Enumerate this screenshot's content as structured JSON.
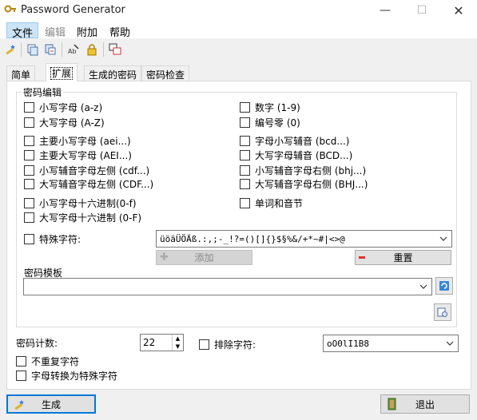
{
  "window": {
    "title": "Password Generator"
  },
  "menu": {
    "items": [
      "文件",
      "编辑",
      "附加",
      "帮助"
    ]
  },
  "tabs": [
    "简单",
    "扩展",
    "生成的密码",
    "密码检查"
  ],
  "group": {
    "title": "密码编辑",
    "left_options": [
      "小写字母 (a-z)",
      "大写字母 (A-Z)",
      "主要小写字母 (aei...)",
      "主要大写字母 (AEI...)",
      "小写辅音字母左侧 (cdf...)",
      "大写辅音字母左侧 (CDF...)",
      "小写字母十六进制(0-f)",
      "大写字母十六进制 (0-F)"
    ],
    "right_options": [
      "数字 (1-9)",
      "编号零 (0)",
      "字母小写辅音 (bcd...)",
      "大写字母辅音 (BCD...)",
      "小写辅音字母右侧 (bhj...)",
      "大写辅音字母右侧 (BHJ...)",
      "单词和音节"
    ],
    "special_chars_label": "特殊字符:",
    "special_chars_value": "üöäÜÖÄß.:,;-_!?=()[]{}$§%&/+*~#|<>@",
    "add_button": "添加",
    "reset_button": "重置",
    "template_label": "密码模板",
    "template_value": ""
  },
  "bottom": {
    "count_label": "密码计数:",
    "count_value": "22",
    "exclude_label": "排除字符:",
    "exclude_value": "oO0lI1B8",
    "no_repeat_label": "不重复字符",
    "convert_label": "字母转换为特殊字符"
  },
  "footer": {
    "generate_button": "生成",
    "exit_button": "退出"
  },
  "colors": {
    "accent": "#0078d7",
    "menu_highlight": "#cce4f7",
    "reset_icon": "#e03030"
  }
}
